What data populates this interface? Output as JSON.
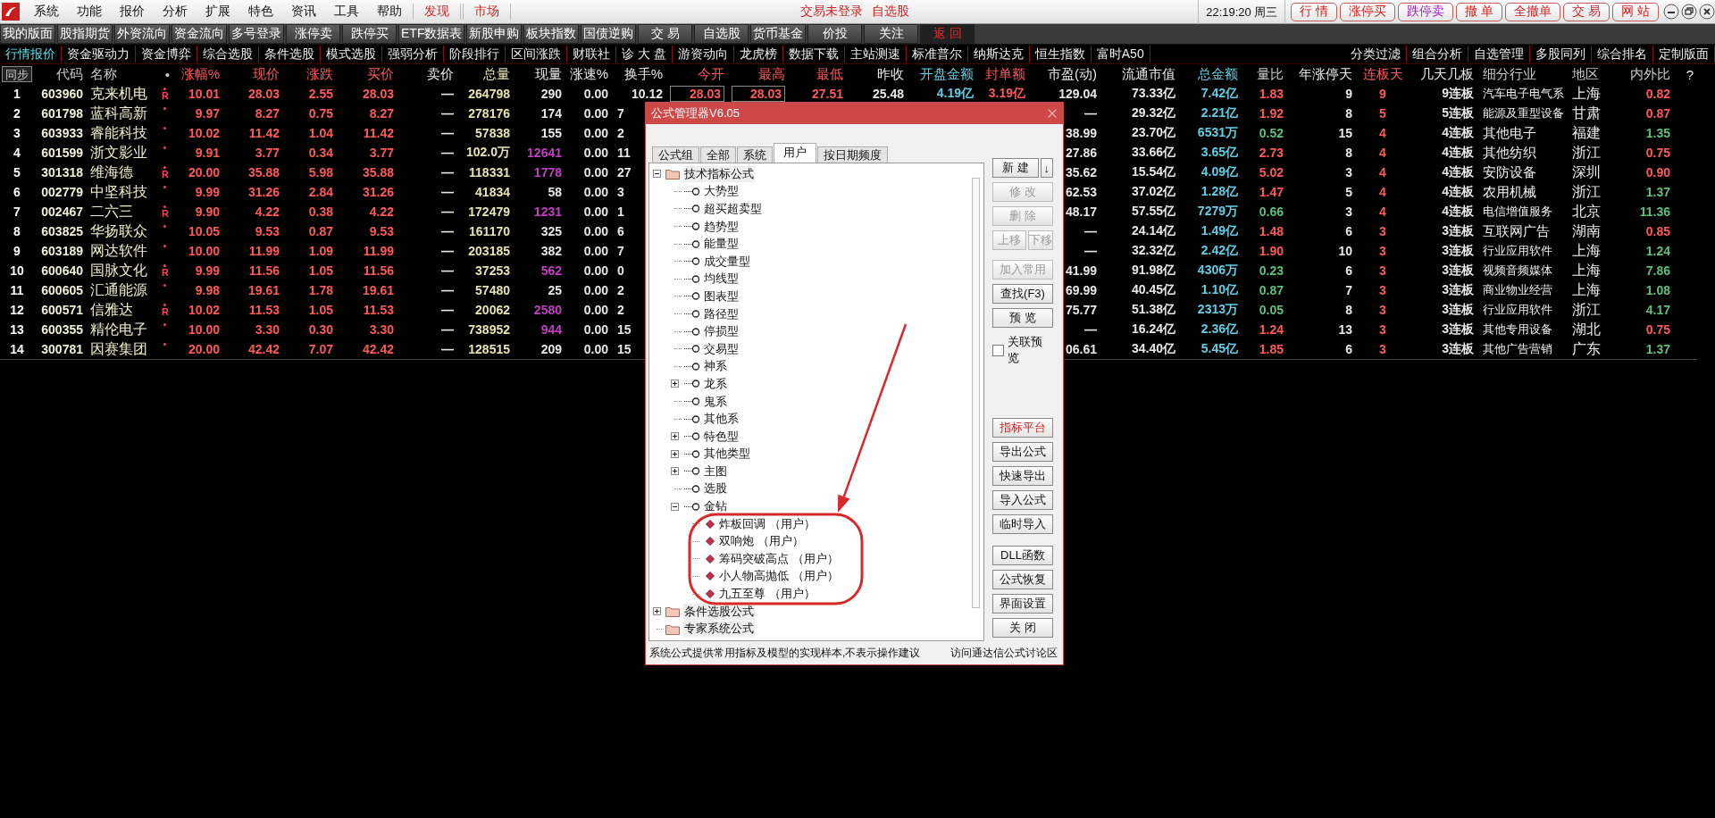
{
  "menu_bar": {
    "menus": [
      "系统",
      "功能",
      "报价",
      "分析",
      "扩展",
      "特色",
      "资讯",
      "工具",
      "帮助"
    ],
    "links": [
      "发现",
      "市场"
    ],
    "login_status": "交易未登录",
    "watchlist": "自选股",
    "clock": "22:19:20 周三",
    "quick_buttons": [
      {
        "label": "行 情",
        "color": "#d42020"
      },
      {
        "label": "涨停买",
        "color": "#d42020"
      },
      {
        "label": "跌停卖",
        "color": "#a020c0"
      },
      {
        "label": "撤 单",
        "color": "#d42020"
      },
      {
        "label": "全撤单",
        "color": "#d42020"
      },
      {
        "label": "交 易",
        "color": "#d42020"
      },
      {
        "label": "网 站",
        "color": "#d42020"
      }
    ]
  },
  "toolbar": {
    "buttons": [
      {
        "label": "我的版面",
        "kind": "normal"
      },
      {
        "label": "股指期货",
        "kind": "normal"
      },
      {
        "label": "外资流向",
        "kind": "normal"
      },
      {
        "label": "资金流向",
        "kind": "normal"
      },
      {
        "label": "多号登录",
        "kind": "normal"
      },
      {
        "label": "涨停卖",
        "kind": "normal"
      },
      {
        "label": "跌停买",
        "kind": "normal"
      },
      {
        "label": "ETF数据表",
        "kind": "normal"
      },
      {
        "label": "新股申购",
        "kind": "normal"
      },
      {
        "label": "板块指数",
        "kind": "normal"
      },
      {
        "label": "国债逆购",
        "kind": "normal"
      },
      {
        "label": "交 易",
        "kind": "normal"
      },
      {
        "label": "自选股",
        "kind": "normal"
      },
      {
        "label": "货币基金",
        "kind": "normal"
      },
      {
        "label": "价投",
        "kind": "normal"
      },
      {
        "label": "关注",
        "kind": "normal"
      },
      {
        "label": "返 回",
        "kind": "back"
      }
    ]
  },
  "nav_tabs": {
    "left": [
      {
        "label": "行情报价",
        "selected": true
      },
      {
        "label": "资金驱动力",
        "selected": false
      },
      {
        "label": "资金博弈",
        "selected": false
      },
      {
        "label": "综合选股",
        "selected": false
      },
      {
        "label": "条件选股",
        "selected": false
      },
      {
        "label": "模式选股",
        "selected": false
      },
      {
        "label": "强弱分析",
        "selected": false
      },
      {
        "label": "阶段排行",
        "selected": false
      },
      {
        "label": "区间涨跌",
        "selected": false
      },
      {
        "label": "财联社",
        "selected": false
      },
      {
        "label": "诊 大 盘",
        "selected": false
      },
      {
        "label": "游资动向",
        "selected": false
      },
      {
        "label": "龙虎榜",
        "selected": false
      },
      {
        "label": "数据下载",
        "selected": false
      },
      {
        "label": "主站测速",
        "selected": false
      },
      {
        "label": "标准普尔",
        "selected": false
      },
      {
        "label": "纳斯达克",
        "selected": false
      },
      {
        "label": "恒生指数",
        "selected": false
      },
      {
        "label": "富时A50",
        "selected": false
      }
    ],
    "right": [
      {
        "label": "分类过滤",
        "selected": false
      },
      {
        "label": "组合分析",
        "selected": false
      },
      {
        "label": "自选管理",
        "selected": false
      },
      {
        "label": "多股同列",
        "selected": false
      },
      {
        "label": "综合排名",
        "selected": false
      },
      {
        "label": "定制版面",
        "selected": false
      }
    ]
  },
  "table": {
    "columns": [
      "同步",
      "代码",
      "名称",
      "•",
      "涨幅%",
      "现价",
      "涨跌",
      "买价",
      "卖价",
      "总量",
      "现量",
      "涨速%",
      "换手%",
      "今开",
      "最高",
      "最低",
      "昨收",
      "开盘金额",
      "封单额",
      "市盈(动)",
      "流通市值",
      "总金额",
      "量比",
      "年涨停天",
      "连板天",
      "几天几板",
      "细分行业",
      "地区",
      "内外比",
      "?"
    ],
    "rows": [
      {
        "sell_volume": false,
        "cells": [
          "1",
          "603960",
          "克来机电",
          "R",
          "10.01",
          "28.03",
          "2.55",
          "28.03",
          "—",
          "264798",
          "290",
          "0.00",
          "10.12",
          "28.03",
          "28.03",
          "27.51",
          "25.48",
          "4.19亿",
          "3.19亿",
          "129.04",
          "73.33亿",
          "7.42亿",
          "1.83",
          "9",
          "9",
          "9连板",
          "汽车电子电气系",
          "上海",
          "0.82"
        ]
      },
      {
        "sell_volume": false,
        "cells": [
          "2",
          "601798",
          "蓝科高新",
          "",
          "9.97",
          "8.27",
          "0.75",
          "8.27",
          "—",
          "278176",
          "174",
          "0.00",
          "7",
          "",
          "",
          "",
          "",
          "",
          "",
          "—",
          "29.32亿",
          "2.21亿",
          "1.92",
          "8",
          "5",
          "5连板",
          "能源及重型设备",
          "甘肃",
          "0.87"
        ]
      },
      {
        "sell_volume": false,
        "cells": [
          "3",
          "603933",
          "睿能科技",
          "",
          "10.02",
          "11.42",
          "1.04",
          "11.42",
          "—",
          "57838",
          "155",
          "0.00",
          "2",
          "",
          "",
          "",
          "",
          "",
          "",
          "38.99",
          "23.70亿",
          "6531万",
          "0.52",
          "15",
          "4",
          "4连板",
          "其他电子",
          "福建",
          "1.35"
        ]
      },
      {
        "sell_volume": true,
        "cells": [
          "4",
          "601599",
          "浙文影业",
          "",
          "9.91",
          "3.77",
          "0.34",
          "3.77",
          "—",
          "102.0万",
          "12641",
          "0.00",
          "11",
          "",
          "",
          "",
          "",
          "",
          "",
          "27.86",
          "33.66亿",
          "3.65亿",
          "2.73",
          "8",
          "4",
          "4连板",
          "其他纺织",
          "浙江",
          "0.75"
        ]
      },
      {
        "sell_volume": true,
        "cells": [
          "5",
          "301318",
          "维海德",
          "R",
          "20.00",
          "35.88",
          "5.98",
          "35.88",
          "—",
          "118331",
          "1778",
          "0.00",
          "27",
          "",
          "",
          "",
          "",
          "",
          "",
          "35.62",
          "15.54亿",
          "4.09亿",
          "5.02",
          "3",
          "4",
          "4连板",
          "安防设备",
          "深圳",
          "0.90"
        ]
      },
      {
        "sell_volume": false,
        "cells": [
          "6",
          "002779",
          "中坚科技",
          "",
          "9.99",
          "31.26",
          "2.84",
          "31.26",
          "—",
          "41834",
          "58",
          "0.00",
          "3",
          "",
          "",
          "",
          "",
          "",
          "",
          "62.53",
          "37.02亿",
          "1.28亿",
          "1.47",
          "5",
          "4",
          "4连板",
          "农用机械",
          "浙江",
          "1.37"
        ]
      },
      {
        "sell_volume": true,
        "cells": [
          "7",
          "002467",
          "二六三",
          "R",
          "9.90",
          "4.22",
          "0.38",
          "4.22",
          "—",
          "172479",
          "1231",
          "0.00",
          "1",
          "",
          "",
          "",
          "",
          "",
          "",
          "48.17",
          "57.55亿",
          "7279万",
          "0.66",
          "3",
          "4",
          "4连板",
          "电信增值服务",
          "北京",
          "11.36"
        ]
      },
      {
        "sell_volume": false,
        "cells": [
          "8",
          "603825",
          "华扬联众",
          "",
          "10.05",
          "9.53",
          "0.87",
          "9.53",
          "—",
          "161170",
          "325",
          "0.00",
          "6",
          "",
          "",
          "",
          "",
          "",
          "",
          "—",
          "24.14亿",
          "1.49亿",
          "1.48",
          "6",
          "3",
          "3连板",
          "互联网广告",
          "湖南",
          "0.85"
        ]
      },
      {
        "sell_volume": false,
        "cells": [
          "9",
          "603189",
          "网达软件",
          "",
          "10.00",
          "11.99",
          "1.09",
          "11.99",
          "—",
          "203185",
          "382",
          "0.00",
          "7",
          "",
          "",
          "",
          "",
          "",
          "",
          "—",
          "32.32亿",
          "2.42亿",
          "1.90",
          "10",
          "3",
          "3连板",
          "行业应用软件",
          "上海",
          "1.24"
        ]
      },
      {
        "sell_volume": true,
        "cells": [
          "10",
          "600640",
          "国脉文化",
          "R",
          "9.99",
          "11.56",
          "1.05",
          "11.56",
          "—",
          "37253",
          "562",
          "0.00",
          "0",
          "",
          "",
          "",
          "",
          "",
          "",
          "41.99",
          "91.98亿",
          "4306万",
          "0.23",
          "6",
          "3",
          "3连板",
          "视频音频媒体",
          "上海",
          "7.86"
        ]
      },
      {
        "sell_volume": false,
        "cells": [
          "11",
          "600605",
          "汇通能源",
          "",
          "9.98",
          "19.61",
          "1.78",
          "19.61",
          "—",
          "57480",
          "25",
          "0.00",
          "2",
          "",
          "",
          "",
          "",
          "",
          "",
          "69.99",
          "40.45亿",
          "1.10亿",
          "0.87",
          "7",
          "3",
          "3连板",
          "商业物业经营",
          "上海",
          "1.08"
        ]
      },
      {
        "sell_volume": true,
        "cells": [
          "12",
          "600571",
          "信雅达",
          "R",
          "10.02",
          "11.53",
          "1.05",
          "11.53",
          "—",
          "20062",
          "2580",
          "0.00",
          "2",
          "",
          "",
          "",
          "",
          "",
          "",
          "75.77",
          "51.38亿",
          "2313万",
          "0.05",
          "8",
          "3",
          "3连板",
          "行业应用软件",
          "浙江",
          "4.17"
        ]
      },
      {
        "sell_volume": true,
        "cells": [
          "13",
          "600355",
          "精伦电子",
          "",
          "10.00",
          "3.30",
          "0.30",
          "3.30",
          "—",
          "738952",
          "944",
          "0.00",
          "15",
          "",
          "",
          "",
          "",
          "",
          "",
          "—",
          "16.24亿",
          "2.36亿",
          "1.24",
          "13",
          "3",
          "3连板",
          "其他专用设备",
          "湖北",
          "0.75"
        ]
      },
      {
        "sell_volume": false,
        "cells": [
          "14",
          "300781",
          "因赛集团",
          "",
          "20.00",
          "42.42",
          "7.07",
          "42.42",
          "—",
          "128515",
          "209",
          "0.00",
          "15",
          "",
          "",
          "",
          "",
          "",
          "",
          "06.61",
          "34.40亿",
          "5.45亿",
          "1.85",
          "6",
          "3",
          "3连板",
          "其他广告营销",
          "广东",
          "1.37"
        ]
      }
    ]
  },
  "dialog": {
    "title": "公式管理器V6.05",
    "tabs": [
      {
        "label": "公式组",
        "selected": false
      },
      {
        "label": "全部",
        "selected": false
      },
      {
        "label": "系统",
        "selected": false
      },
      {
        "label": "用户",
        "selected": true
      },
      {
        "label": "按日期频度",
        "selected": false
      }
    ],
    "tree": [
      {
        "label": "技术指标公式",
        "kind": "folder",
        "expanded": true,
        "children": [
          {
            "label": "大势型",
            "kind": "group"
          },
          {
            "label": "超买超卖型",
            "kind": "group"
          },
          {
            "label": "趋势型",
            "kind": "group"
          },
          {
            "label": "能量型",
            "kind": "group"
          },
          {
            "label": "成交量型",
            "kind": "group"
          },
          {
            "label": "均线型",
            "kind": "group"
          },
          {
            "label": "图表型",
            "kind": "group"
          },
          {
            "label": "路径型",
            "kind": "group"
          },
          {
            "label": "停损型",
            "kind": "group"
          },
          {
            "label": "交易型",
            "kind": "group"
          },
          {
            "label": "神系",
            "kind": "group"
          },
          {
            "label": "龙系",
            "kind": "group",
            "expanded": false
          },
          {
            "label": "鬼系",
            "kind": "group"
          },
          {
            "label": "其他系",
            "kind": "group"
          },
          {
            "label": "特色型",
            "kind": "group",
            "expanded": false
          },
          {
            "label": "其他类型",
            "kind": "group",
            "expanded": false
          },
          {
            "label": "主图",
            "kind": "group",
            "expanded": false
          },
          {
            "label": "选股",
            "kind": "group"
          },
          {
            "label": "金钻",
            "kind": "group",
            "expanded": true,
            "children": [
              {
                "label": "炸板回调 （用户）",
                "kind": "formula"
              },
              {
                "label": "双响炮 （用户）",
                "kind": "formula"
              },
              {
                "label": "筹码突破高点 （用户）",
                "kind": "formula"
              },
              {
                "label": "小人物高抛低 （用户）",
                "kind": "formula"
              },
              {
                "label": "九五至尊 （用户）",
                "kind": "formula"
              }
            ]
          }
        ]
      },
      {
        "label": "条件选股公式",
        "kind": "folder",
        "expanded": false
      },
      {
        "label": "专家系统公式",
        "kind": "folder"
      }
    ],
    "button_sections": [
      [
        [
          {
            "label": "新 建",
            "disabled": false,
            "kind": "normal"
          },
          {
            "label": "↓",
            "disabled": false,
            "kind": "normal"
          }
        ],
        [
          {
            "label": "修 改",
            "disabled": true,
            "kind": "normal"
          }
        ],
        [
          {
            "label": "删 除",
            "disabled": true,
            "kind": "normal"
          }
        ],
        [
          {
            "label": "上移",
            "disabled": true,
            "kind": "normal"
          },
          {
            "label": "下移",
            "disabled": true,
            "kind": "normal"
          }
        ]
      ],
      [
        [
          {
            "label": "加入常用",
            "disabled": true,
            "kind": "normal"
          }
        ],
        [
          {
            "label": "查找(F3)",
            "disabled": false,
            "kind": "normal"
          }
        ],
        [
          {
            "label": "预 览",
            "disabled": false,
            "kind": "normal"
          }
        ]
      ],
      [
        [
          {
            "label": "指标平台",
            "disabled": false,
            "kind": "accent"
          }
        ],
        [
          {
            "label": "导出公式",
            "disabled": false,
            "kind": "normal"
          }
        ],
        [
          {
            "label": "快速导出",
            "disabled": false,
            "kind": "normal"
          }
        ],
        [
          {
            "label": "导入公式",
            "disabled": false,
            "kind": "normal"
          }
        ],
        [
          {
            "label": "临时导入",
            "disabled": false,
            "kind": "normal"
          }
        ]
      ],
      [
        [
          {
            "label": "DLL函数",
            "disabled": false,
            "kind": "normal"
          }
        ],
        [
          {
            "label": "公式恢复",
            "disabled": false,
            "kind": "normal"
          }
        ],
        [
          {
            "label": "界面设置",
            "disabled": false,
            "kind": "normal"
          }
        ],
        [
          {
            "label": "关 闭",
            "disabled": false,
            "kind": "normal"
          }
        ]
      ]
    ],
    "preview_checkbox": {
      "label": "关联预览",
      "checked": false
    },
    "footer_note": "系统公式提供常用指标及模型的实现样本,不表示操作建议",
    "footer_link": "访问通达信公式讨论区"
  }
}
